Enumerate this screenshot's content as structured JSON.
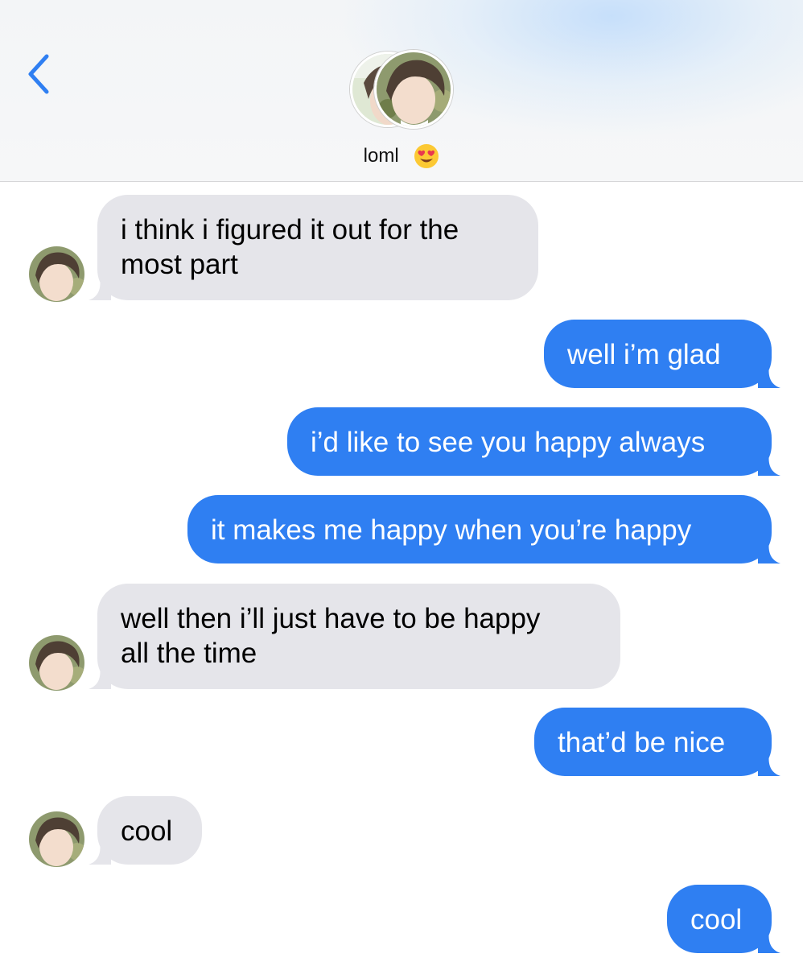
{
  "header": {
    "back_icon": "chevron-left-icon",
    "contact_name": "loml",
    "contact_emoji": "heart-eyes-emoji"
  },
  "colors": {
    "accent": "#2f7ff2",
    "incoming_bubble": "#e5e5ea",
    "outgoing_bubble": "#2f7ff2",
    "back_chevron": "#2f7ff2"
  },
  "messages": [
    {
      "side": "incoming",
      "lines": [
        "i think i figured it out for the",
        "most part"
      ]
    },
    {
      "side": "outgoing",
      "lines": [
        "well i’m glad"
      ]
    },
    {
      "side": "outgoing",
      "lines": [
        "i’d like to see you happy always"
      ]
    },
    {
      "side": "outgoing",
      "lines": [
        "it makes me happy when you’re happy"
      ]
    },
    {
      "side": "incoming",
      "lines": [
        "well then i’ll just have to be happy",
        "all the time"
      ]
    },
    {
      "side": "outgoing",
      "lines": [
        "that’d be nice"
      ]
    },
    {
      "side": "incoming",
      "lines": [
        "cool"
      ]
    },
    {
      "side": "outgoing",
      "lines": [
        "cool"
      ]
    }
  ]
}
